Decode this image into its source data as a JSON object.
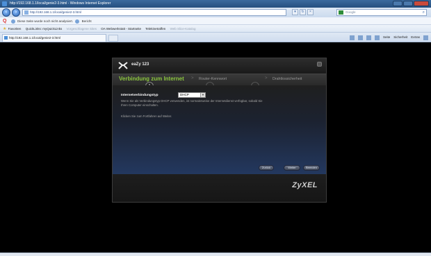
{
  "window": {
    "title": "http://192.168.1.1/local/genie2-3.html - Windows Internet Explorer"
  },
  "address_bar": {
    "url": "http://192.168.1.1/local/genie2-3.html",
    "search_placeholder": "Google"
  },
  "info_bar": {
    "message": "Diese Seite wurde noch nicht analysiert.",
    "report_label": "Bericht"
  },
  "favorites_bar": {
    "label": "Favoriten",
    "items": [
      "QuickLinks: myQuickLinks",
      "Vorgeschlagene Sites",
      "OA Webwerkstatt - Startseite",
      "Telekinetraffen",
      "Web Slice-Katalog"
    ]
  },
  "tab": {
    "title": "http://192.168.1.1/local/genie2-3.html"
  },
  "command_bar": {
    "items": [
      "Seite",
      "Sicherheit",
      "Extras"
    ]
  },
  "wizard": {
    "title": "eaZy 123",
    "steps": [
      {
        "label": "Verbindung zum Internet",
        "number": "1"
      },
      {
        "label": "Router-Kennwort",
        "number": "2"
      },
      {
        "label": "Drahtlossicherheit",
        "number": "3"
      }
    ],
    "separator": ">",
    "field_label": "Internetverbindungstyp",
    "select_value": "DHCP",
    "hint": "Wenn Sie als Verbindungstyp DHCP verwenden, ist normalerweise der Internetdienst verfügbar, sobald Sie Ihren Computer einschalten.",
    "continue_hint": "Klicken Sie zum Fortfahren auf Weiter.",
    "buttons": [
      "Zurück",
      "Weiter",
      "Beenden"
    ],
    "brand": "ZyXEL"
  },
  "colors": {
    "active_step": "#8cc63f",
    "panel_gradient_end": "#23385f"
  }
}
